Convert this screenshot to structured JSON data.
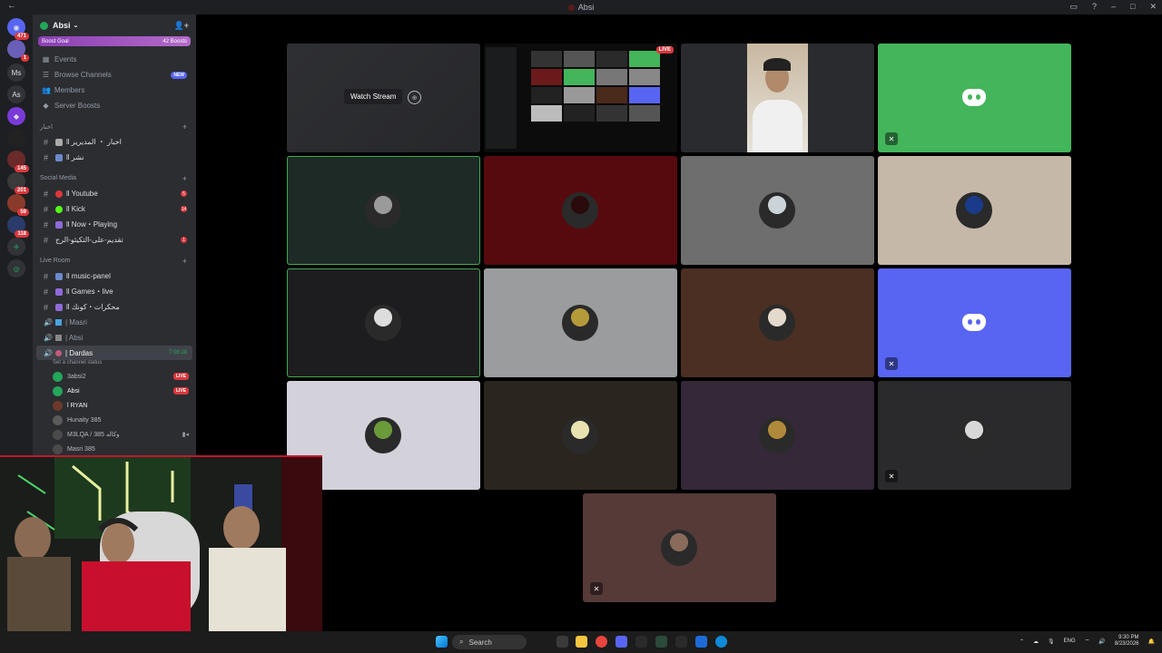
{
  "window": {
    "title": "Absi"
  },
  "server": {
    "name": "Absi",
    "boost_goal": "Boost Goal",
    "boost_count": "42 Boosts"
  },
  "guild_badges": [
    "471",
    "1",
    "145",
    "201",
    "59",
    "118"
  ],
  "guild_labels": [
    "Ms",
    "As"
  ],
  "nav": [
    {
      "label": "Events",
      "icon": "calendar-icon"
    },
    {
      "label": "Browse Channels",
      "icon": "browse-icon",
      "badge": "NEW"
    },
    {
      "label": "Members",
      "icon": "members-icon"
    },
    {
      "label": "Server Boosts",
      "icon": "boost-icon"
    }
  ],
  "categories": {
    "news": "اخبار",
    "social": "Social Media",
    "live": "Live Room"
  },
  "news_channels": [
    {
      "label": "ll اخبار ・ المديرير"
    },
    {
      "label": "ll نشر"
    }
  ],
  "social_channels": [
    {
      "label": "ll Youtube",
      "badge": "5",
      "color": "#da373c"
    },
    {
      "label": "ll Kick",
      "badge": "14",
      "color": "#53fc18"
    },
    {
      "label": "ll Now・Playing",
      "badge": "",
      "color": "#8e6ad8"
    },
    {
      "label": "تقديم-على-التكيئو-الرج",
      "badge": "1",
      "color": "#8e6ad8"
    }
  ],
  "live_channels": [
    {
      "label": "ll music-panel"
    },
    {
      "label": "ll Games・live"
    },
    {
      "label": "ll محكرات・كونك"
    }
  ],
  "voice_channels": [
    {
      "label": "| Masri"
    },
    {
      "label": "| Absi"
    }
  ],
  "active_voice": {
    "label": "| Dardas",
    "timer": "7:08:18",
    "status": "Set a channel status"
  },
  "voice_users": [
    {
      "name": "3absi2",
      "live": "LIVE",
      "color": "#23a55a"
    },
    {
      "name": "Absi",
      "live": "LIVE",
      "color": "#23a55a"
    },
    {
      "name": "l RYAN",
      "live": "",
      "color": "#6b3a2a"
    },
    {
      "name": "Hunaity 385",
      "live": "",
      "color": "#5a5a5a"
    },
    {
      "name": "M3LQA / وكاله 385",
      "live": "",
      "color": "#4a4a4a",
      "cam": "camera-icon"
    },
    {
      "name": "Masri 385",
      "live": "",
      "color": "#4a4a4a"
    }
  ],
  "stream": {
    "watch_label": "Watch Stream",
    "live_label": "LIVE"
  },
  "tiles": [
    {
      "bg": "#2a2b2e",
      "kind": "stream"
    },
    {
      "bg": "#111",
      "kind": "stream-live"
    },
    {
      "bg": "#2a2b2e",
      "kind": "camera"
    },
    {
      "bg": "#43b55a",
      "kind": "discord",
      "mute": true
    },
    {
      "bg": "#1d2a26",
      "kind": "avatar",
      "sel": true,
      "av": "#9a9a9a"
    },
    {
      "bg": "#560a0e",
      "kind": "avatar",
      "av": "#2a0a0a"
    },
    {
      "bg": "#6e6e6e",
      "kind": "avatar",
      "av": "#c9d3d8"
    },
    {
      "bg": "#c5b8a8",
      "kind": "avatar",
      "av": "#1a3a8a"
    },
    {
      "bg": "#1d1d1f",
      "kind": "avatar",
      "sel": true,
      "av": "#ddd"
    },
    {
      "bg": "#9a9c9e",
      "kind": "avatar",
      "av": "#b59a3a"
    },
    {
      "bg": "#4a2f22",
      "kind": "avatar",
      "av": "#e3d9cc"
    },
    {
      "bg": "#5865f2",
      "kind": "discord",
      "mute": true
    },
    {
      "bg": "#d3d1da",
      "kind": "avatar",
      "av": "#6a9a3a"
    },
    {
      "bg": "#2a261f",
      "kind": "avatar",
      "av": "#e8e2b0"
    },
    {
      "bg": "#352838",
      "kind": "avatar",
      "av": "#b08a3a"
    },
    {
      "bg": "#2a2a2c",
      "kind": "avatar",
      "mute": true,
      "av": "#d8d8d8"
    },
    {
      "bg": "#553a38",
      "kind": "avatar",
      "mute": true,
      "av": "#8a6a5a"
    }
  ],
  "taskbar": {
    "search": "Search",
    "lang": "ENG",
    "time": "9:30 PM",
    "date": "8/23/2026"
  },
  "colors": {
    "accent": "#5865f2",
    "green": "#23a55a",
    "red": "#da373c"
  }
}
